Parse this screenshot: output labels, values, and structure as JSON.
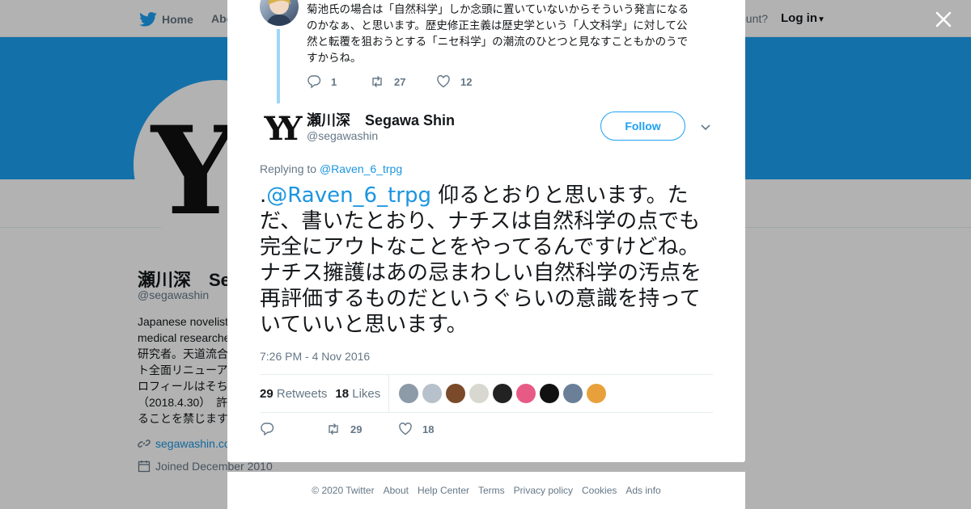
{
  "background": {
    "nav": {
      "home": "Home",
      "about": "Abo",
      "account": "ccount?",
      "login": "Log in"
    },
    "profile": {
      "name": "瀬川深　Se",
      "handle": "@segawashin",
      "bio": "Japanese novelist\nmedical researche\n研究者。天道流合\nト全面リニューア\nロフィールはそち\n（2018.4.30）　許\nることを禁じます",
      "link": "segawashin.co",
      "joined": "Joined December 2010"
    }
  },
  "previous_tweet": {
    "text": "菊池氏の場合は「自然科学」しか念頭に置いていないからそういう発言になる\nのかなぁ、と思います。歴史修正主義は歴史学という「人文科学」に対して公\n然と転覆を狙おうとする「ニセ科学」の潮流のひとつと見なすこともかのうで\nすからね。",
    "replies": "1",
    "retweets": "27",
    "likes": "12"
  },
  "tweet": {
    "name": "瀬川深　Segawa Shin",
    "handle": "@segawashin",
    "follow_label": "Follow",
    "replying_prefix": "Replying to ",
    "replying_to": "@Raven_6_trpg",
    "text_lead": ".",
    "mention": "@Raven_6_trpg",
    "text_body": " 仰るとおりと思います。ただ、書いたとおり、ナチスは自然科学の点でも完全にアウトなことをやってるんですけどね。ナチス擁護はあの忌まわしい自然科学の汚点を再評価するものだというぐらいの意識を持っていていいと思います。",
    "timestamp": "7:26 PM - 4 Nov 2016",
    "retweets_count": "29",
    "retweets_label": "Retweets",
    "likes_count": "18",
    "likes_label": "Likes",
    "action_retweets": "29",
    "action_likes": "18",
    "liker_colors": [
      "#8d9aa8",
      "#b7c1cc",
      "#7a4a2a",
      "#d8d8d0",
      "#222222",
      "#e85a86",
      "#111111",
      "#6b7f99",
      "#e8a13a"
    ]
  },
  "footer": [
    "© 2020 Twitter",
    "About",
    "Help Center",
    "Terms",
    "Privacy policy",
    "Cookies",
    "Ads info"
  ],
  "colors": {
    "accent": "#1da1f2",
    "link": "#1b95e0",
    "muted": "#657786"
  }
}
